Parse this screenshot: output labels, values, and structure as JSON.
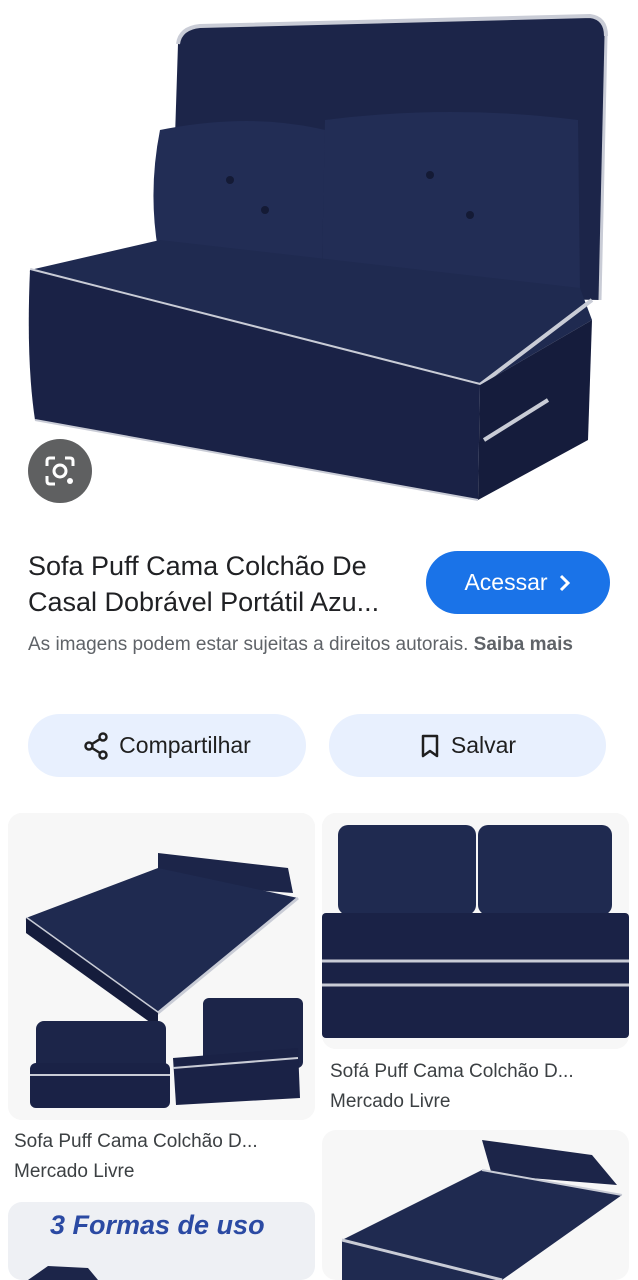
{
  "product": {
    "title_line1": "Sofa Puff Cama Colchão De",
    "title_line2": "Casal Dobrável Portátil Azu...",
    "visit_label": "Acessar",
    "copyright_text": "As imagens podem estar sujeitas a direitos autorais.",
    "learn_more": "Saiba mais"
  },
  "actions": {
    "share_label": "Compartilhar",
    "save_label": "Salvar"
  },
  "related": [
    {
      "caption": "Sofa Puff Cama Colchão D...",
      "source": "Mercado Livre"
    },
    {
      "caption": "Sofá Puff Cama Colchão D...",
      "source": "Mercado Livre"
    },
    {
      "promo": "3 Formas de uso"
    }
  ],
  "colors": {
    "accent": "#1a73e8",
    "pill_bg": "#e8f0fe",
    "sofa": "#1f2a4f"
  },
  "icons": [
    "lens-icon",
    "chevron-right-icon",
    "share-icon",
    "bookmark-icon"
  ]
}
